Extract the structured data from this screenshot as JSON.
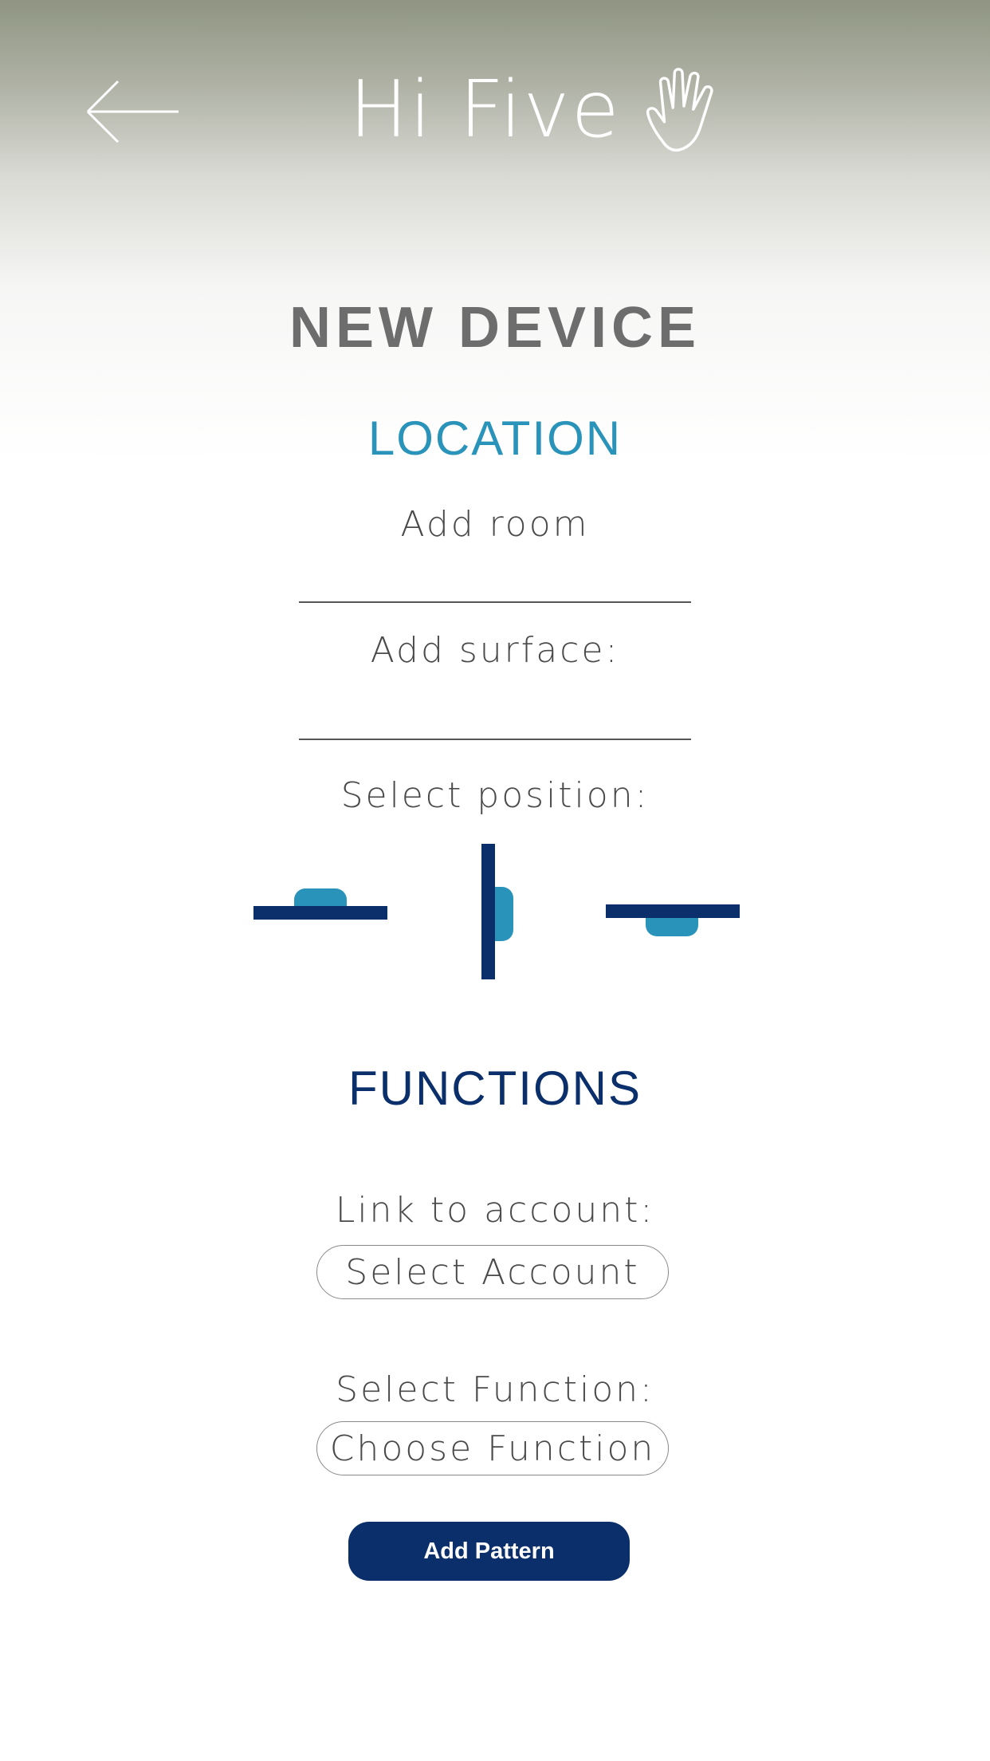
{
  "header": {
    "app_name": "Hi Five",
    "back_icon": "arrow-left-icon",
    "logo_icon": "hand-icon"
  },
  "page": {
    "title": "NEW DEVICE"
  },
  "location": {
    "title": "LOCATION",
    "room_label": "Add room",
    "surface_label": "Add surface:",
    "position_label": "Select position:",
    "positions": [
      "top-mount",
      "side-mount",
      "bottom-mount"
    ]
  },
  "functions": {
    "title": "FUNCTIONS",
    "account_label": "Link to account:",
    "account_select": "Select Account",
    "function_label": "Select Function:",
    "function_select": "Choose Function",
    "add_button": "Add Pattern"
  },
  "colors": {
    "header_top": "#8f9582",
    "accent_light": "#2a93ba",
    "accent_dark": "#0b2f6a",
    "title_gray": "#6d6d6d"
  }
}
